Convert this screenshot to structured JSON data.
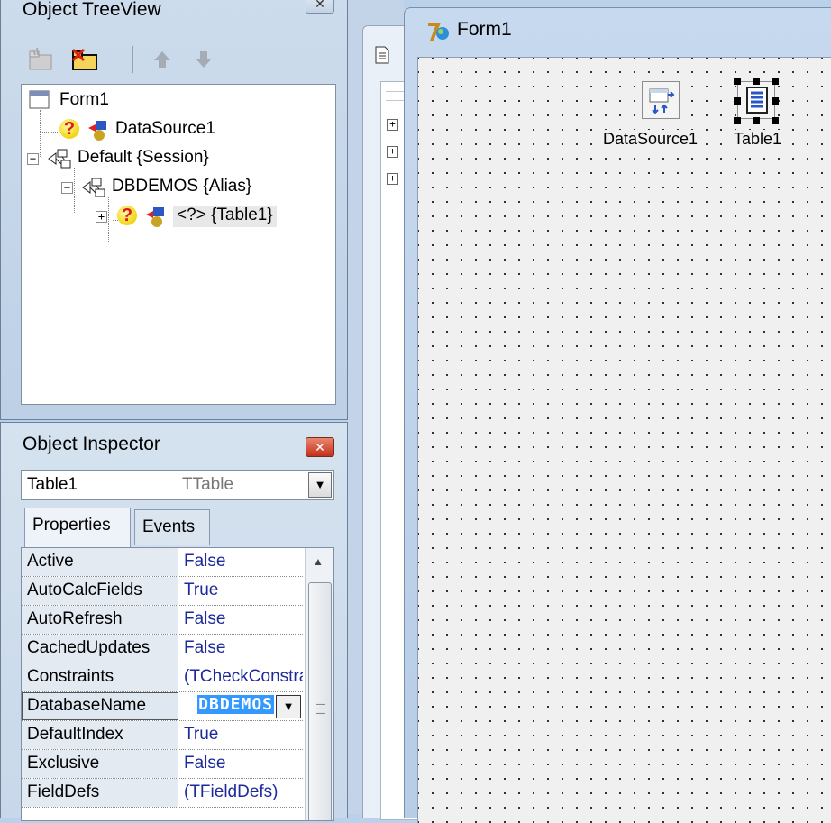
{
  "treeview": {
    "title": "Object TreeView",
    "nodes": [
      {
        "label": "Form1"
      },
      {
        "label": "DataSource1"
      },
      {
        "label": "Default {Session}"
      },
      {
        "label": "DBDEMOS {Alias}"
      },
      {
        "label": "<?> {Table1}"
      }
    ]
  },
  "inspector": {
    "title": "Object Inspector",
    "selected_object": "Table1",
    "selected_type": "TTable",
    "tabs": [
      {
        "label": "Properties"
      },
      {
        "label": "Events"
      }
    ],
    "properties": [
      {
        "name": "Active",
        "value": "False"
      },
      {
        "name": "AutoCalcFields",
        "value": "True"
      },
      {
        "name": "AutoRefresh",
        "value": "False"
      },
      {
        "name": "CachedUpdates",
        "value": "False"
      },
      {
        "name": "Constraints",
        "value": "(TCheckConstraints)"
      },
      {
        "name": "DatabaseName",
        "value": "DBDEMOS"
      },
      {
        "name": "DefaultIndex",
        "value": "True"
      },
      {
        "name": "Exclusive",
        "value": "False"
      },
      {
        "name": "FieldDefs",
        "value": "(TFieldDefs)"
      }
    ]
  },
  "form": {
    "title": "Form1",
    "components": [
      {
        "label": "DataSource1"
      },
      {
        "label": "Table1"
      }
    ]
  },
  "colors": {
    "accent_selection": "#3399ff",
    "property_value": "#1d2a9c",
    "close_red": "#c3311a"
  },
  "icons": [
    "close-icon",
    "new-folder-icon",
    "delete-icon",
    "arrow-up-icon",
    "arrow-down-icon",
    "form-icon",
    "question-icon",
    "datasource-icon",
    "session-icon",
    "table-icon",
    "dropdown-arrow-icon"
  ]
}
